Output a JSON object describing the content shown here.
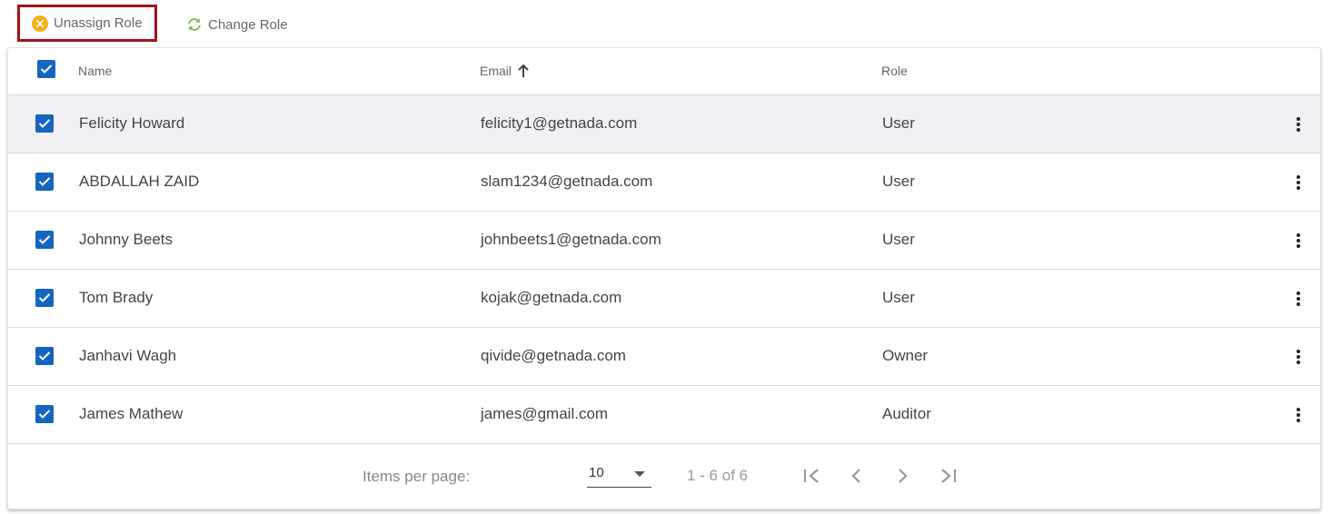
{
  "toolbar": {
    "unassign_label": "Unassign Role",
    "change_label": "Change Role"
  },
  "table": {
    "columns": {
      "name": "Name",
      "email": "Email",
      "role": "Role"
    },
    "rows": [
      {
        "name": "Felicity Howard",
        "email": "felicity1@getnada.com",
        "role": "User",
        "checked": true
      },
      {
        "name": "ABDALLAH ZAID",
        "email": "slam1234@getnada.com",
        "role": "User",
        "checked": true
      },
      {
        "name": "Johnny Beets",
        "email": "johnbeets1@getnada.com",
        "role": "User",
        "checked": true
      },
      {
        "name": "Tom Brady",
        "email": "kojak@getnada.com",
        "role": "User",
        "checked": true
      },
      {
        "name": "Janhavi Wagh",
        "email": "qivide@getnada.com",
        "role": "Owner",
        "checked": true
      },
      {
        "name": "James Mathew",
        "email": "james@gmail.com",
        "role": "Auditor",
        "checked": true
      }
    ]
  },
  "paginator": {
    "items_per_page_label": "Items per page:",
    "page_size": "10",
    "range_label": "1 - 6 of 6"
  },
  "colors": {
    "accent": "#1565c0",
    "highlight_border": "#a4121b",
    "unassign_icon": "#f2b01e",
    "change_icon": "#7cb342"
  }
}
